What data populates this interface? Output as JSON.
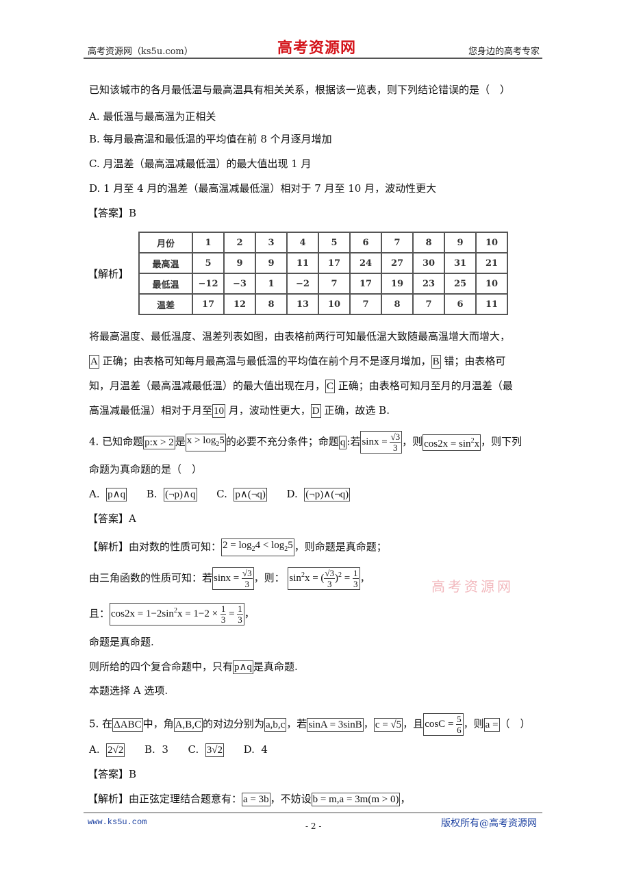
{
  "header": {
    "left": "高考资源网（ks5u.com）",
    "logo": "高考资源网",
    "right": "您身边的高考专家"
  },
  "q3": {
    "stem": "已知该城市的各月最低温与最高温具有相关关系，根据该一览表，则下列结论错误的是（　）",
    "options": [
      "A.  最低温与最高温为正相关",
      "B.  每月最高温和最低温的平均值在前 8 个月逐月增加",
      "C.  月温差（最高温减最低温）的最大值出现 1 月",
      "D.  1 月至 4 月的温差（最高温减最低温）相对于 7 月至 10 月，波动性更大"
    ],
    "answer": "【答案】B",
    "analysis_label": "【解析】",
    "table": {
      "rows": [
        {
          "head": "月份",
          "cells": [
            "1",
            "2",
            "3",
            "4",
            "5",
            "6",
            "7",
            "8",
            "9",
            "10"
          ]
        },
        {
          "head": "最高温",
          "cells": [
            "5",
            "9",
            "9",
            "11",
            "17",
            "24",
            "27",
            "30",
            "31",
            "21"
          ]
        },
        {
          "head": "最低温",
          "cells": [
            "−12",
            "−3",
            "1",
            "−2",
            "7",
            "17",
            "19",
            "23",
            "25",
            "10"
          ]
        },
        {
          "head": "温差",
          "cells": [
            "17",
            "12",
            "8",
            "13",
            "10",
            "7",
            "8",
            "7",
            "6",
            "11"
          ]
        }
      ]
    },
    "analysis": {
      "l1": "将最高温度、最低温度、温差列表如图，由表格前两行可知最低温大致随最高温增大而增大，",
      "l2a": "A",
      "l2b": " 正确；由表格可知每月最高温与最低温的平均值在前个月不是逐月增加，",
      "l2c": "B",
      "l2d": " 错；由表格可",
      "l3a": "知，月温差（最高温减最低温）的最大值出现在月，",
      "l3b": "C",
      "l3c": " 正确；由表格可知月至月的月温差（最",
      "l4a": "高温减最低温）相对于月至",
      "l4b": "10",
      "l4c": " 月，波动性更大，",
      "l4d": "D",
      "l4e": " 正确，故选 B."
    }
  },
  "q4": {
    "s1": "4.  已知命题",
    "m1": "p:x > 2",
    "s2": "是",
    "m2a": "x > log",
    "m2sub": "2",
    "m2b": "5",
    "s3": "的必要不充分条件；命题",
    "m3": "q",
    "s4": ":若",
    "m4a": "sinx = ",
    "m4num": "√3",
    "m4den": "3",
    "s5": "，则",
    "m5a": "cos2x = sin",
    "m5sup": "2",
    "m5b": "x",
    "s6": "，则下列",
    "line2": "命题为真命题的是（　）",
    "options": [
      {
        "label": "A.",
        "math": "p∧q"
      },
      {
        "label": "B.",
        "math": "(¬p)∧q"
      },
      {
        "label": "C.",
        "math": "p∧(¬q)"
      },
      {
        "label": "D.",
        "math": "(¬p)∧(¬q)"
      }
    ],
    "answer": "【答案】A",
    "a1": "【解析】由对数的性质可知：",
    "a1m_a": "2 = log",
    "a1m_s1": "2",
    "a1m_b": "4 < log",
    "a1m_s2": "2",
    "a1m_c": "5",
    "a1b": "，则命题是真命题；",
    "a2": "由三角函数的性质可知：若",
    "a2m_a": "sinx = ",
    "a2m_num": "√3",
    "a2m_den": "3",
    "a2b": "，则：",
    "a2m2_a": "sin",
    "a2m2_sup": "2",
    "a2m2_b": "x = (",
    "a2m2_num": "√3",
    "a2m2_den": "3",
    "a2m2_c": ")",
    "a2m2_sup2": "2",
    "a2m2_d": " = ",
    "a2m2_num2": "1",
    "a2m2_den2": "3",
    "a2c": "，",
    "a3": "且：",
    "a3m_a": "cos2x = 1−2sin",
    "a3m_sup": "2",
    "a3m_b": "x = 1−2 × ",
    "a3m_num": "1",
    "a3m_den": "3",
    "a3m_c": " = ",
    "a3m_num2": "1",
    "a3m_den2": "3",
    "a3b": "，",
    "a4": "命题是真命题.",
    "a5a": "则所给的四个复合命题中，只有",
    "a5m": "p∧q",
    "a5b": "是真命题.",
    "a6": "本题选择 A 选项."
  },
  "q5": {
    "s1": "5.  在",
    "m1": "ΔABC",
    "s2": "中，角",
    "m2": "A,B,C",
    "s3": "的对边分别为",
    "m3": "a,b,c",
    "s4": "，若",
    "m4": "sinA = 3sinB",
    "s5": "，",
    "m5": "c = √5",
    "s6": "，且",
    "m6a": "cosC = ",
    "m6num": "5",
    "m6den": "6",
    "s7": "，则",
    "m7": "a =",
    "s8": "（　）",
    "options": [
      {
        "label": "A.",
        "math": "2√2",
        "boxed": true
      },
      {
        "label": "B.",
        "text": "3"
      },
      {
        "label": "C.",
        "math": "3√2",
        "boxed": true
      },
      {
        "label": "D.",
        "text": "4"
      }
    ],
    "answer": "【答案】B",
    "a1": "【解析】由正弦定理结合题意有：",
    "a1m": "a = 3b",
    "a1b": "，不妨设",
    "a1m2": "b = m,a = 3m(m > 0)",
    "a1c": "，"
  },
  "watermark": "高考资源网",
  "footer": {
    "left": "www.ks5u.com",
    "page": "- 2 -",
    "right": "版权所有@高考资源网"
  }
}
